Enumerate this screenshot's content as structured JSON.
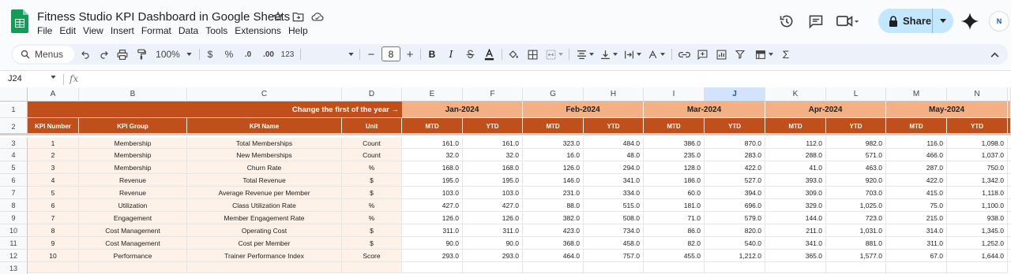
{
  "app": {
    "title": "Fitness Studio KPI Dashboard in Google Sheets",
    "menu": [
      "File",
      "Edit",
      "View",
      "Insert",
      "Format",
      "Data",
      "Tools",
      "Extensions",
      "Help"
    ],
    "share_label": "Share",
    "avatar_text": "N"
  },
  "toolbar": {
    "menus_label": "Menus",
    "zoom": "100%",
    "currency": "$",
    "percent": "%",
    "dec_less": ".0",
    "dec_more": ".00",
    "num_format": "123",
    "font_size": "8",
    "bold": "B",
    "italic": "I"
  },
  "formula_bar": {
    "name_box": "J24",
    "fx": "fx"
  },
  "columns": [
    "A",
    "B",
    "C",
    "D",
    "E",
    "F",
    "G",
    "H",
    "I",
    "J",
    "K",
    "L",
    "M",
    "N"
  ],
  "selected_column": "J",
  "row_numbers": [
    "1",
    "2",
    "3",
    "4",
    "5",
    "6",
    "7",
    "8",
    "9",
    "10",
    "11",
    "12",
    "13"
  ],
  "sheet": {
    "note": "Change the first of the year →",
    "months": [
      "Jan-2024",
      "Feb-2024",
      "Mar-2024",
      "Apr-2024",
      "May-2024"
    ],
    "headers": [
      "KPI Number",
      "KPI Group",
      "KPI Name",
      "Unit"
    ],
    "sub_headers": [
      "MTD",
      "YTD",
      "MTD",
      "YTD",
      "MTD",
      "YTD",
      "MTD",
      "YTD",
      "MTD",
      "YTD"
    ],
    "rows": [
      {
        "num": "1",
        "group": "Membership",
        "name": "Total Memberships",
        "unit": "Count",
        "values": [
          "161.0",
          "161.0",
          "323.0",
          "484.0",
          "386.0",
          "870.0",
          "112.0",
          "982.0",
          "116.0",
          "1,098.0"
        ]
      },
      {
        "num": "2",
        "group": "Membership",
        "name": "New Memberships",
        "unit": "Count",
        "values": [
          "32.0",
          "32.0",
          "16.0",
          "48.0",
          "235.0",
          "283.0",
          "288.0",
          "571.0",
          "466.0",
          "1,037.0"
        ]
      },
      {
        "num": "3",
        "group": "Membership",
        "name": "Churn Rate",
        "unit": "%",
        "values": [
          "168.0",
          "168.0",
          "126.0",
          "294.0",
          "128.0",
          "422.0",
          "41.0",
          "463.0",
          "287.0",
          "750.0"
        ]
      },
      {
        "num": "4",
        "group": "Revenue",
        "name": "Total Revenue",
        "unit": "$",
        "values": [
          "195.0",
          "195.0",
          "146.0",
          "341.0",
          "186.0",
          "527.0",
          "393.0",
          "920.0",
          "422.0",
          "1,342.0"
        ]
      },
      {
        "num": "5",
        "group": "Revenue",
        "name": "Average Revenue per Member",
        "unit": "$",
        "values": [
          "103.0",
          "103.0",
          "231.0",
          "334.0",
          "60.0",
          "394.0",
          "309.0",
          "703.0",
          "415.0",
          "1,118.0"
        ]
      },
      {
        "num": "6",
        "group": "Utilization",
        "name": "Class Utilization Rate",
        "unit": "%",
        "values": [
          "427.0",
          "427.0",
          "88.0",
          "515.0",
          "181.0",
          "696.0",
          "329.0",
          "1,025.0",
          "75.0",
          "1,100.0"
        ]
      },
      {
        "num": "7",
        "group": "Engagement",
        "name": "Member Engagement Rate",
        "unit": "%",
        "values": [
          "126.0",
          "126.0",
          "382.0",
          "508.0",
          "71.0",
          "579.0",
          "144.0",
          "723.0",
          "215.0",
          "938.0"
        ]
      },
      {
        "num": "8",
        "group": "Cost Management",
        "name": "Operating Cost",
        "unit": "$",
        "values": [
          "311.0",
          "311.0",
          "423.0",
          "734.0",
          "86.0",
          "820.0",
          "211.0",
          "1,031.0",
          "314.0",
          "1,345.0"
        ]
      },
      {
        "num": "9",
        "group": "Cost Management",
        "name": "Cost per Member",
        "unit": "$",
        "values": [
          "90.0",
          "90.0",
          "368.0",
          "458.0",
          "82.0",
          "540.0",
          "341.0",
          "881.0",
          "311.0",
          "1,252.0"
        ]
      },
      {
        "num": "10",
        "group": "Performance",
        "name": "Trainer Performance Index",
        "unit": "Score",
        "values": [
          "293.0",
          "293.0",
          "464.0",
          "757.0",
          "455.0",
          "1,212.0",
          "365.0",
          "1,577.0",
          "67.0",
          "1,644.0"
        ]
      }
    ]
  }
}
